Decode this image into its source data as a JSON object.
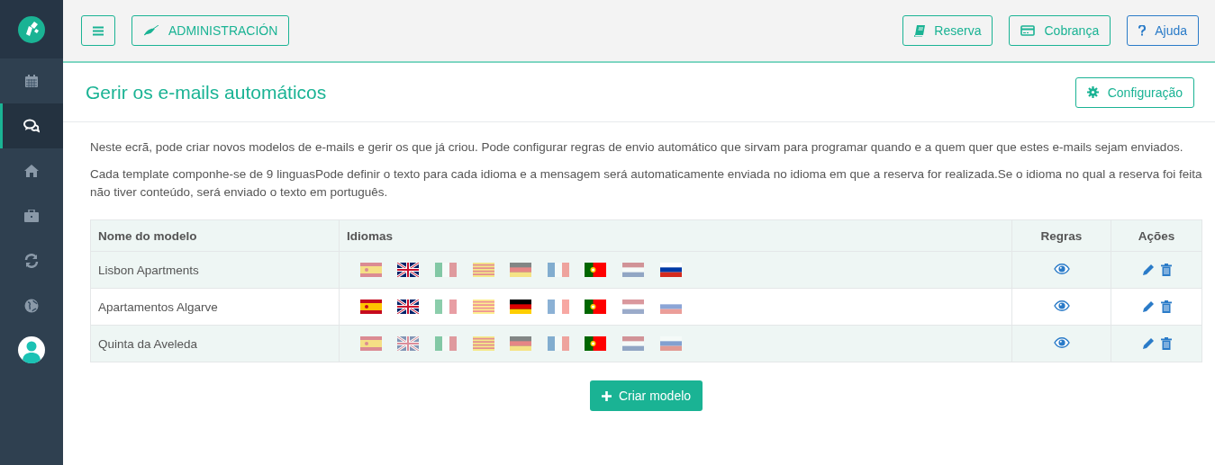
{
  "sidebar": {
    "items": [
      {
        "kind": "calendar",
        "selected": false
      },
      {
        "kind": "chat",
        "selected": true
      },
      {
        "kind": "home",
        "selected": false
      },
      {
        "kind": "briefcase",
        "selected": false
      },
      {
        "kind": "refresh",
        "selected": false
      },
      {
        "kind": "globe",
        "selected": false
      }
    ]
  },
  "header": {
    "left_buttons": [
      {
        "kind": "menu"
      },
      {
        "kind": "admin",
        "label": "ADMINISTRACIÓN"
      }
    ],
    "right_buttons": [
      {
        "kind": "book",
        "label": "Reserva"
      },
      {
        "kind": "card",
        "label": "Cobrança"
      },
      {
        "kind": "help",
        "label": "Ajuda"
      }
    ]
  },
  "page": {
    "title": "Gerir os e-mails automáticos",
    "config_button": "Configuração",
    "paragraphs": [
      "Neste ecrã, pode criar novos modelos de e-mails e gerir os que já criou. Pode configurar regras de envio automático que sirvam para programar quando e a quem quer que estes e-mails sejam enviados.",
      "Cada template componhe-se de 9 linguasPode definir o texto para cada idioma e a mensagem será automaticamente enviada no idioma em que a reserva for realizada.Se o idioma no qual a reserva foi feita não tiver conteúdo, será enviado o texto em português."
    ]
  },
  "table": {
    "columns": [
      "Nome do modelo",
      "Idiomas",
      "Regras",
      "Ações"
    ],
    "rows": [
      {
        "name": "Lisbon Apartments",
        "flags": [
          {
            "kind": "es",
            "filled": false
          },
          {
            "kind": "gb",
            "filled": true
          },
          {
            "kind": "it",
            "filled": false
          },
          {
            "kind": "ca",
            "filled": false
          },
          {
            "kind": "de",
            "filled": false
          },
          {
            "kind": "fr",
            "filled": false
          },
          {
            "kind": "pt",
            "filled": true
          },
          {
            "kind": "nl",
            "filled": false
          },
          {
            "kind": "ru",
            "filled": true
          }
        ]
      },
      {
        "name": "Apartamentos Algarve",
        "flags": [
          {
            "kind": "es",
            "filled": true
          },
          {
            "kind": "gb",
            "filled": true
          },
          {
            "kind": "it",
            "filled": false
          },
          {
            "kind": "ca",
            "filled": false
          },
          {
            "kind": "de",
            "filled": true
          },
          {
            "kind": "fr",
            "filled": false
          },
          {
            "kind": "pt",
            "filled": true
          },
          {
            "kind": "nl",
            "filled": false
          },
          {
            "kind": "ru",
            "filled": false
          }
        ]
      },
      {
        "name": "Quinta da Aveleda",
        "flags": [
          {
            "kind": "es",
            "filled": false
          },
          {
            "kind": "gb",
            "filled": false
          },
          {
            "kind": "it",
            "filled": false
          },
          {
            "kind": "ca",
            "filled": false
          },
          {
            "kind": "de",
            "filled": false
          },
          {
            "kind": "fr",
            "filled": false
          },
          {
            "kind": "pt",
            "filled": true
          },
          {
            "kind": "nl",
            "filled": false
          },
          {
            "kind": "ru",
            "filled": false
          }
        ]
      }
    ]
  },
  "create_button": "Criar modelo"
}
